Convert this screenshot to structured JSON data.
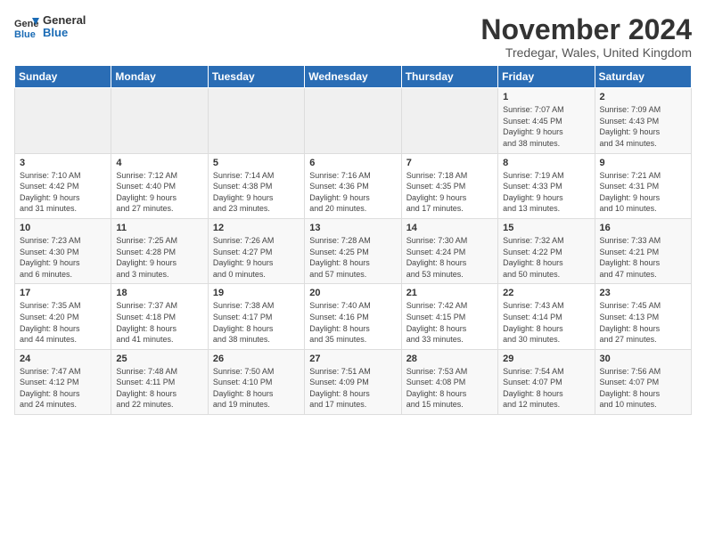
{
  "logo": {
    "line1": "General",
    "line2": "Blue"
  },
  "title": "November 2024",
  "location": "Tredegar, Wales, United Kingdom",
  "days_of_week": [
    "Sunday",
    "Monday",
    "Tuesday",
    "Wednesday",
    "Thursday",
    "Friday",
    "Saturday"
  ],
  "weeks": [
    [
      {
        "day": "",
        "info": ""
      },
      {
        "day": "",
        "info": ""
      },
      {
        "day": "",
        "info": ""
      },
      {
        "day": "",
        "info": ""
      },
      {
        "day": "",
        "info": ""
      },
      {
        "day": "1",
        "info": "Sunrise: 7:07 AM\nSunset: 4:45 PM\nDaylight: 9 hours\nand 38 minutes."
      },
      {
        "day": "2",
        "info": "Sunrise: 7:09 AM\nSunset: 4:43 PM\nDaylight: 9 hours\nand 34 minutes."
      }
    ],
    [
      {
        "day": "3",
        "info": "Sunrise: 7:10 AM\nSunset: 4:42 PM\nDaylight: 9 hours\nand 31 minutes."
      },
      {
        "day": "4",
        "info": "Sunrise: 7:12 AM\nSunset: 4:40 PM\nDaylight: 9 hours\nand 27 minutes."
      },
      {
        "day": "5",
        "info": "Sunrise: 7:14 AM\nSunset: 4:38 PM\nDaylight: 9 hours\nand 23 minutes."
      },
      {
        "day": "6",
        "info": "Sunrise: 7:16 AM\nSunset: 4:36 PM\nDaylight: 9 hours\nand 20 minutes."
      },
      {
        "day": "7",
        "info": "Sunrise: 7:18 AM\nSunset: 4:35 PM\nDaylight: 9 hours\nand 17 minutes."
      },
      {
        "day": "8",
        "info": "Sunrise: 7:19 AM\nSunset: 4:33 PM\nDaylight: 9 hours\nand 13 minutes."
      },
      {
        "day": "9",
        "info": "Sunrise: 7:21 AM\nSunset: 4:31 PM\nDaylight: 9 hours\nand 10 minutes."
      }
    ],
    [
      {
        "day": "10",
        "info": "Sunrise: 7:23 AM\nSunset: 4:30 PM\nDaylight: 9 hours\nand 6 minutes."
      },
      {
        "day": "11",
        "info": "Sunrise: 7:25 AM\nSunset: 4:28 PM\nDaylight: 9 hours\nand 3 minutes."
      },
      {
        "day": "12",
        "info": "Sunrise: 7:26 AM\nSunset: 4:27 PM\nDaylight: 9 hours\nand 0 minutes."
      },
      {
        "day": "13",
        "info": "Sunrise: 7:28 AM\nSunset: 4:25 PM\nDaylight: 8 hours\nand 57 minutes."
      },
      {
        "day": "14",
        "info": "Sunrise: 7:30 AM\nSunset: 4:24 PM\nDaylight: 8 hours\nand 53 minutes."
      },
      {
        "day": "15",
        "info": "Sunrise: 7:32 AM\nSunset: 4:22 PM\nDaylight: 8 hours\nand 50 minutes."
      },
      {
        "day": "16",
        "info": "Sunrise: 7:33 AM\nSunset: 4:21 PM\nDaylight: 8 hours\nand 47 minutes."
      }
    ],
    [
      {
        "day": "17",
        "info": "Sunrise: 7:35 AM\nSunset: 4:20 PM\nDaylight: 8 hours\nand 44 minutes."
      },
      {
        "day": "18",
        "info": "Sunrise: 7:37 AM\nSunset: 4:18 PM\nDaylight: 8 hours\nand 41 minutes."
      },
      {
        "day": "19",
        "info": "Sunrise: 7:38 AM\nSunset: 4:17 PM\nDaylight: 8 hours\nand 38 minutes."
      },
      {
        "day": "20",
        "info": "Sunrise: 7:40 AM\nSunset: 4:16 PM\nDaylight: 8 hours\nand 35 minutes."
      },
      {
        "day": "21",
        "info": "Sunrise: 7:42 AM\nSunset: 4:15 PM\nDaylight: 8 hours\nand 33 minutes."
      },
      {
        "day": "22",
        "info": "Sunrise: 7:43 AM\nSunset: 4:14 PM\nDaylight: 8 hours\nand 30 minutes."
      },
      {
        "day": "23",
        "info": "Sunrise: 7:45 AM\nSunset: 4:13 PM\nDaylight: 8 hours\nand 27 minutes."
      }
    ],
    [
      {
        "day": "24",
        "info": "Sunrise: 7:47 AM\nSunset: 4:12 PM\nDaylight: 8 hours\nand 24 minutes."
      },
      {
        "day": "25",
        "info": "Sunrise: 7:48 AM\nSunset: 4:11 PM\nDaylight: 8 hours\nand 22 minutes."
      },
      {
        "day": "26",
        "info": "Sunrise: 7:50 AM\nSunset: 4:10 PM\nDaylight: 8 hours\nand 19 minutes."
      },
      {
        "day": "27",
        "info": "Sunrise: 7:51 AM\nSunset: 4:09 PM\nDaylight: 8 hours\nand 17 minutes."
      },
      {
        "day": "28",
        "info": "Sunrise: 7:53 AM\nSunset: 4:08 PM\nDaylight: 8 hours\nand 15 minutes."
      },
      {
        "day": "29",
        "info": "Sunrise: 7:54 AM\nSunset: 4:07 PM\nDaylight: 8 hours\nand 12 minutes."
      },
      {
        "day": "30",
        "info": "Sunrise: 7:56 AM\nSunset: 4:07 PM\nDaylight: 8 hours\nand 10 minutes."
      }
    ]
  ]
}
